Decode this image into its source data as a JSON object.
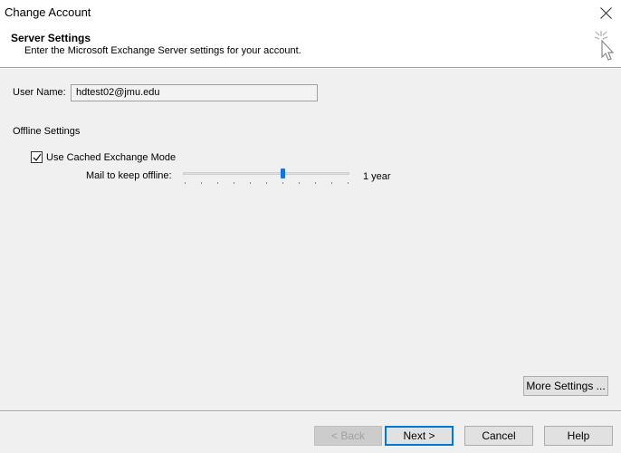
{
  "window": {
    "title": "Change Account",
    "close_icon": "close-icon"
  },
  "header": {
    "title": "Server Settings",
    "subtitle": "Enter the Microsoft Exchange Server settings for your account.",
    "icon": "cursor-click-icon"
  },
  "user": {
    "label": "User Name:",
    "value": "hdtest02@jmu.edu"
  },
  "offline": {
    "heading": "Offline Settings",
    "cached_mode_label": "Use Cached Exchange Mode",
    "cached_mode_checked": true,
    "mail_label": "Mail to keep offline:",
    "slider_value": "1 year",
    "slider_position": 0.6,
    "accent_color": "#1a73d6"
  },
  "buttons": {
    "more_settings": "More Settings ...",
    "back": "< Back",
    "next": "Next >",
    "cancel": "Cancel",
    "help": "Help"
  }
}
